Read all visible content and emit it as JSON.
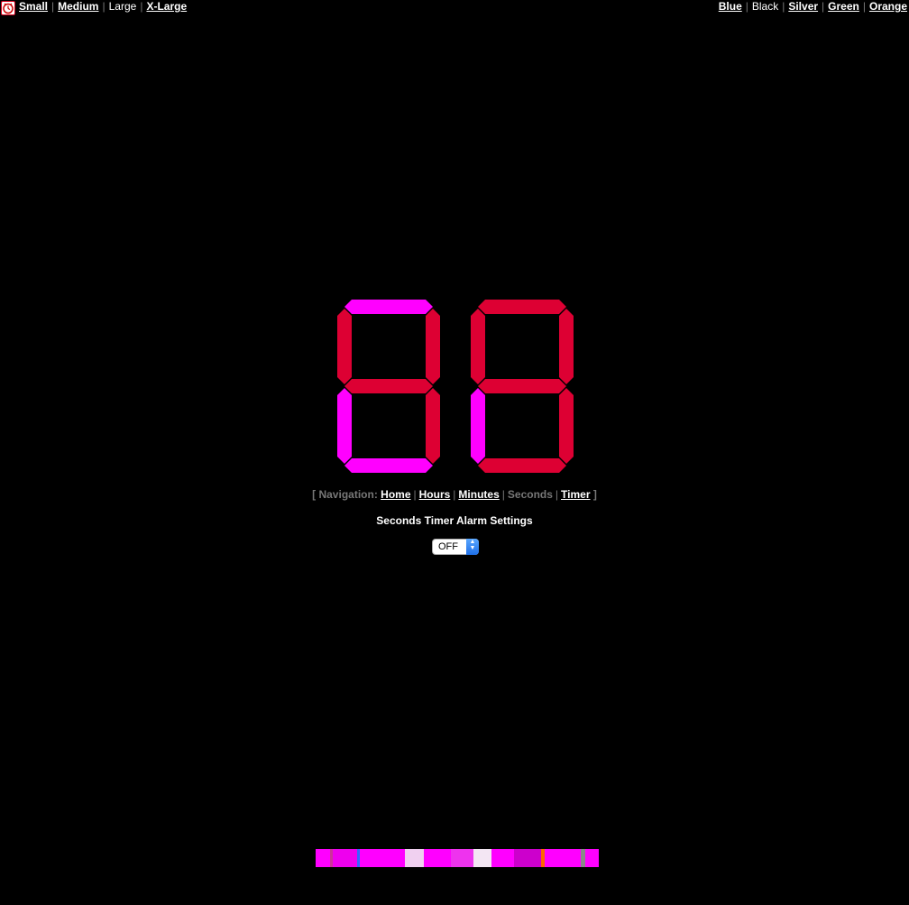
{
  "topbar": {
    "sizes": [
      "Small",
      "Medium",
      "Large",
      "X-Large"
    ],
    "active_size": "Large",
    "colors": [
      "Blue",
      "Black",
      "Silver",
      "Green",
      "Orange"
    ],
    "active_color": "Black"
  },
  "clock": {
    "digits": [
      "4",
      "9"
    ],
    "on_color": "#dd0033",
    "off_color": "#ff00ff"
  },
  "navigation": {
    "open": "[ Navigation:",
    "items": [
      "Home",
      "Hours",
      "Minutes",
      "Seconds",
      "Timer"
    ],
    "current": "Seconds",
    "close": "]"
  },
  "settings": {
    "title": "Seconds Timer Alarm Settings",
    "alarm_value": "OFF"
  },
  "colors": {
    "background": "#000000",
    "segment_lit": "#dd0033",
    "segment_unlit": "#ff00ff",
    "link": "#ffffff",
    "muted": "#777777"
  }
}
